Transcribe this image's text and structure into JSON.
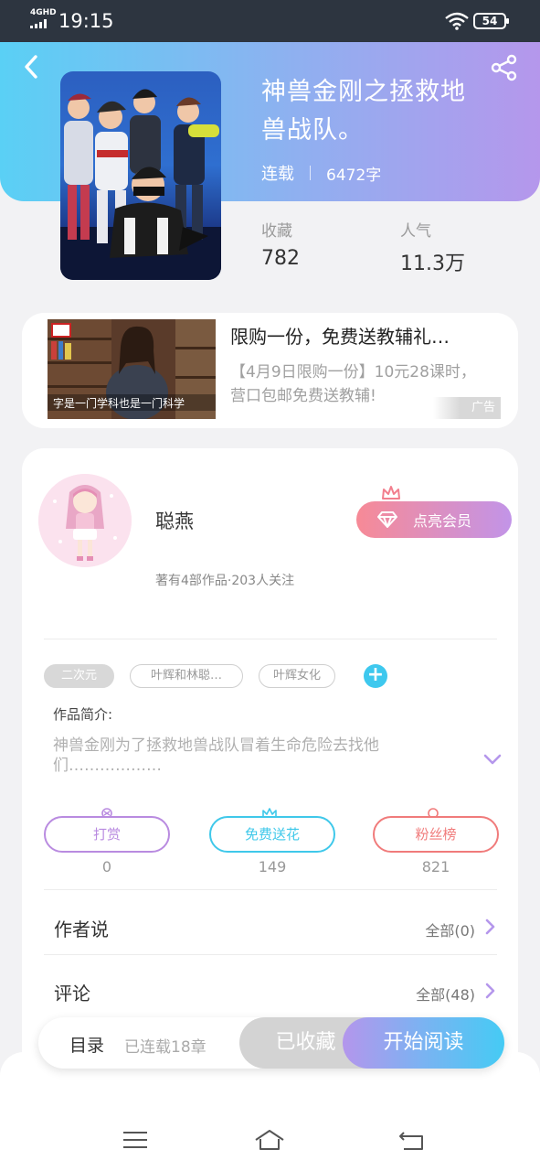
{
  "status_bar": {
    "network": "4GHD",
    "time": "19:15",
    "battery": "54"
  },
  "book": {
    "title": "神兽金刚之拯救地兽战队。",
    "status": "连载",
    "word_count": "6472字",
    "stats": [
      {
        "label": "收藏",
        "value": "782"
      },
      {
        "label": "人气",
        "value": "11.3万"
      }
    ]
  },
  "ad": {
    "title": "限购一份，免费送教辅礼…",
    "description": "【4月9日限购一份】10元28课时，营口包邮免费送教辅!",
    "tag": "广告",
    "thumb_caption": "字是一门学科也是一门科学"
  },
  "author": {
    "name": "聪燕",
    "info": "著有4部作品·203人关注",
    "vip_label": "点亮会员"
  },
  "tags": [
    "二次元",
    "叶辉和林聪…",
    "叶辉女化"
  ],
  "intro": {
    "label": "作品简介:",
    "text": "神兽金刚为了拯救地兽战队冒着生命危险去找他们………………"
  },
  "actions": [
    {
      "label": "打赏",
      "count": "0",
      "color": "#b98be0"
    },
    {
      "label": "免费送花",
      "count": "149",
      "color": "#3fc8ea"
    },
    {
      "label": "粉丝榜",
      "count": "821",
      "color": "#f07b7b"
    }
  ],
  "rows": [
    {
      "title": "作者说",
      "right": "全部(0)"
    },
    {
      "title": "评论",
      "right": "全部(48)"
    }
  ],
  "bottom_bar": {
    "toc_label": "目录",
    "chapter_count": "已连载18章",
    "collected_label": "已收藏",
    "read_label": "开始阅读"
  },
  "icons": {
    "back": "back-icon",
    "share": "share-icon",
    "menu": "menu-icon",
    "home": "home-icon",
    "return": "return-icon"
  },
  "colors": {
    "accent_purple": "#b597ec",
    "accent_cyan": "#45cbf4"
  }
}
